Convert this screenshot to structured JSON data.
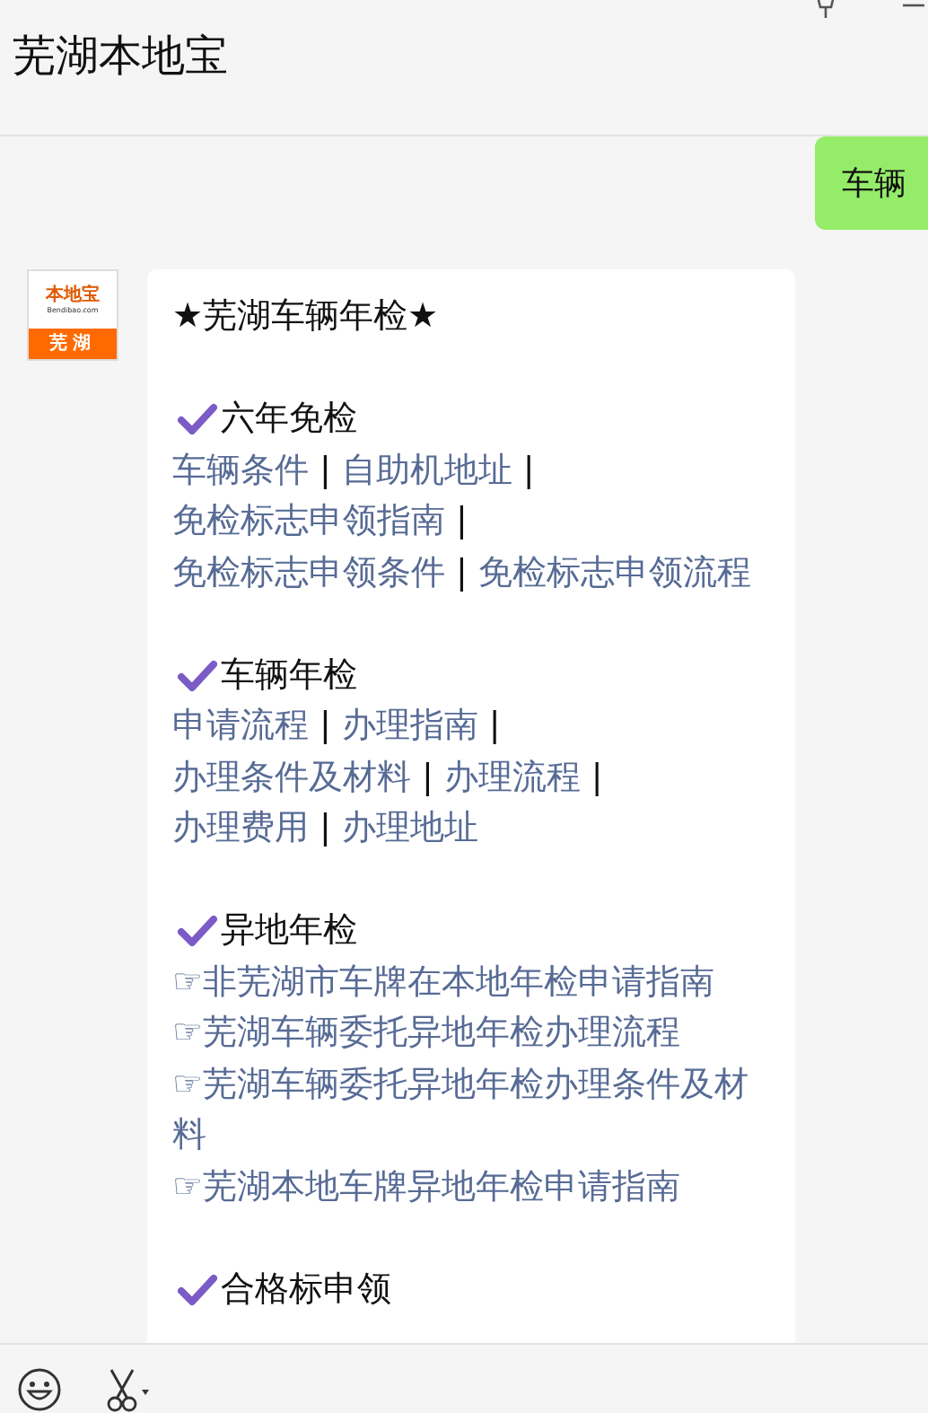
{
  "header": {
    "title": "芜湖本地宝"
  },
  "messages": [
    {
      "kind": "outgoing",
      "text": "车辆"
    },
    {
      "kind": "incoming",
      "avatar": {
        "brand": "本地宝",
        "site": "Bendibao.com",
        "city": "芜湖"
      },
      "title": "★芜湖车辆年检★",
      "separator": "|",
      "sections": [
        {
          "heading": "六年免检",
          "kind": "inline",
          "links": [
            "车辆条件",
            "自助机地址",
            "免检标志申领指南",
            "免检标志申领条件",
            "免检标志申领流程"
          ]
        },
        {
          "heading": "车辆年检",
          "kind": "inline",
          "links": [
            "申请流程",
            "办理指南",
            "办理条件及材料",
            "办理流程",
            "办理费用",
            "办理地址"
          ]
        },
        {
          "heading": "异地年检",
          "kind": "list",
          "links": [
            "☞非芜湖市车牌在本地年检申请指南",
            "☞芜湖车辆委托异地年检办理流程",
            "☞芜湖车辆委托异地年检办理条件及材料",
            "☞芜湖本地车牌异地年检申请指南"
          ]
        },
        {
          "heading": "合格标申领"
        }
      ]
    }
  ]
}
